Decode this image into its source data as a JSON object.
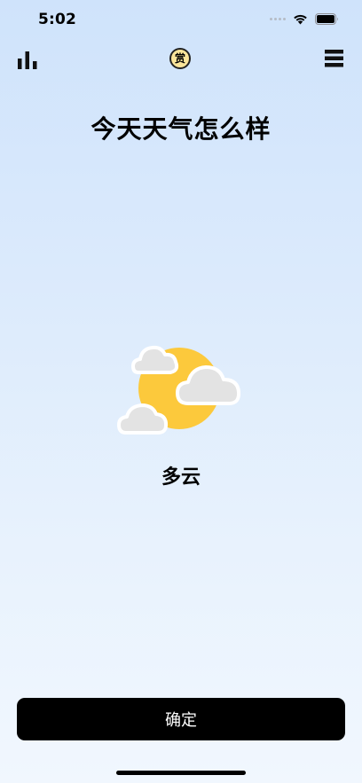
{
  "status_bar": {
    "time": "5:02",
    "icons": [
      "cellular-dots-icon",
      "wifi-icon",
      "battery-icon"
    ]
  },
  "top_bar": {
    "left_icon": "bar-chart-icon",
    "center_badge": "赏",
    "right_icon": "menu-icon"
  },
  "main": {
    "title": "今天天气怎么样",
    "weather_icon": "partly-cloudy-icon",
    "weather_label": "多云"
  },
  "confirm_button": {
    "label": "确定"
  },
  "colors": {
    "sun": "#fcc93c",
    "cloud_fill": "#e3e3e3",
    "cloud_outline": "#ffffff",
    "badge_bg": "#fbe59a",
    "button_bg": "#000000",
    "bg_top": "#cfe3fb",
    "bg_bottom": "#f1f7fe"
  }
}
